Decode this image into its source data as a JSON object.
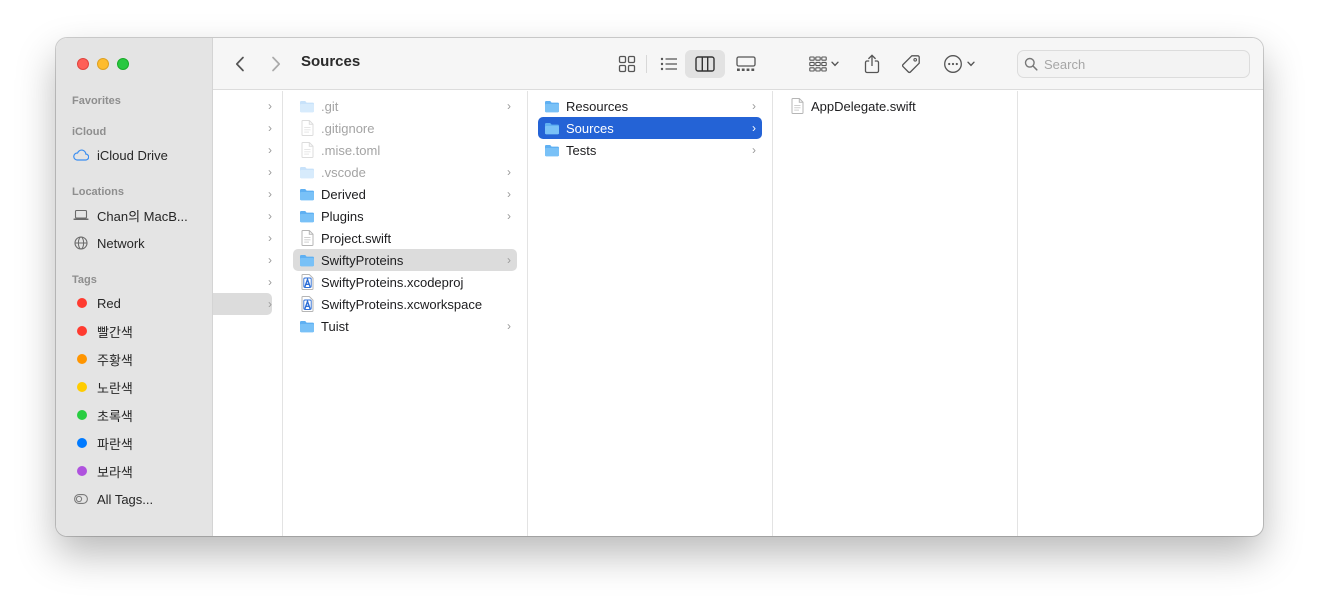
{
  "window": {
    "title": "Sources"
  },
  "toolbar": {
    "back_icon": "chevron-left-icon",
    "forward_icon": "chevron-right-icon",
    "search_placeholder": "Search"
  },
  "sidebar": {
    "favorites_label": "Favorites",
    "icloud_label": "iCloud",
    "icloud_drive": "iCloud Drive",
    "locations_label": "Locations",
    "macbook": "Chan의 MacB...",
    "network": "Network",
    "tags_label": "Tags",
    "tags": [
      {
        "label": "Red",
        "color": "#ff3b30"
      },
      {
        "label": "빨간색",
        "color": "#ff3b30"
      },
      {
        "label": "주황색",
        "color": "#ff9500"
      },
      {
        "label": "노란색",
        "color": "#ffcc00"
      },
      {
        "label": "초록색",
        "color": "#28cd41"
      },
      {
        "label": "파란색",
        "color": "#007aff"
      },
      {
        "label": "보라색",
        "color": "#af52de"
      }
    ],
    "all_tags": "All Tags..."
  },
  "column2": {
    "items": [
      {
        "name": ".git",
        "kind": "folder",
        "dim": true,
        "chevron": true
      },
      {
        "name": ".gitignore",
        "kind": "file",
        "dim": true,
        "chevron": false
      },
      {
        "name": ".mise.toml",
        "kind": "file",
        "dim": true,
        "chevron": false
      },
      {
        "name": ".vscode",
        "kind": "folder",
        "dim": true,
        "chevron": true
      },
      {
        "name": "Derived",
        "kind": "folder",
        "dim": false,
        "chevron": true
      },
      {
        "name": "Plugins",
        "kind": "folder",
        "dim": false,
        "chevron": true
      },
      {
        "name": "Project.swift",
        "kind": "file",
        "dim": false,
        "chevron": false
      },
      {
        "name": "SwiftyProteins",
        "kind": "folder",
        "dim": false,
        "chevron": true
      },
      {
        "name": "SwiftyProteins.xcodeproj",
        "kind": "xcode",
        "dim": false,
        "chevron": false
      },
      {
        "name": "SwiftyProteins.xcworkspace",
        "kind": "xcode",
        "dim": false,
        "chevron": false
      },
      {
        "name": "Tuist",
        "kind": "folder",
        "dim": false,
        "chevron": true
      }
    ]
  },
  "column3": {
    "items": [
      {
        "name": "Resources",
        "kind": "folder"
      },
      {
        "name": "Sources",
        "kind": "folder"
      },
      {
        "name": "Tests",
        "kind": "folder"
      }
    ]
  },
  "column4": {
    "items": [
      {
        "name": "AppDelegate.swift",
        "kind": "file"
      }
    ]
  }
}
